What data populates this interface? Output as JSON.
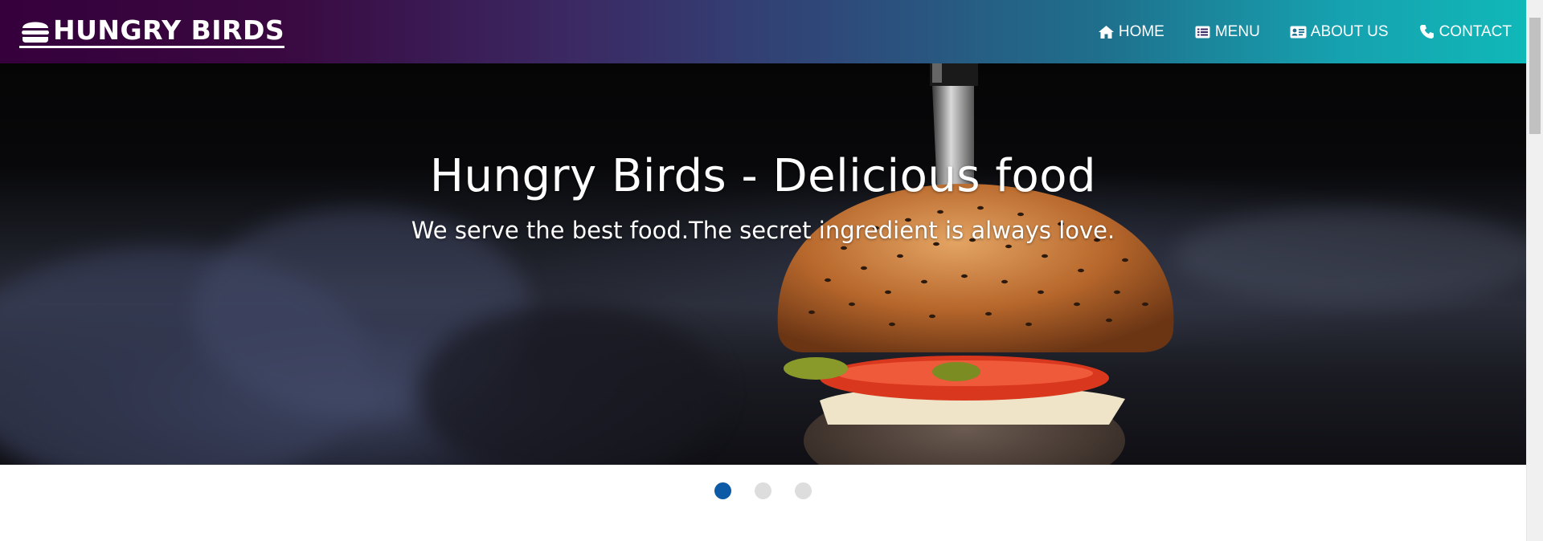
{
  "brand": {
    "name": "HUNGRY BIRDS",
    "icon": "burger-icon"
  },
  "nav": {
    "items": [
      {
        "label": "HOME",
        "icon": "home-icon"
      },
      {
        "label": "MENU",
        "icon": "list-icon"
      },
      {
        "label": "ABOUT US",
        "icon": "id-card-icon"
      },
      {
        "label": "CONTACT",
        "icon": "phone-icon"
      }
    ]
  },
  "hero": {
    "title": "Hungry Birds - Delicious food",
    "subtitle": "We serve the best food.The secret ingredient is always love."
  },
  "carousel": {
    "slide_count": 3,
    "active_index": 0
  },
  "colors": {
    "nav_gradient_start": "#35003c",
    "nav_gradient_end": "#10b8b8",
    "indicator_active": "#0d5aa7",
    "indicator_inactive": "#dddddd"
  }
}
